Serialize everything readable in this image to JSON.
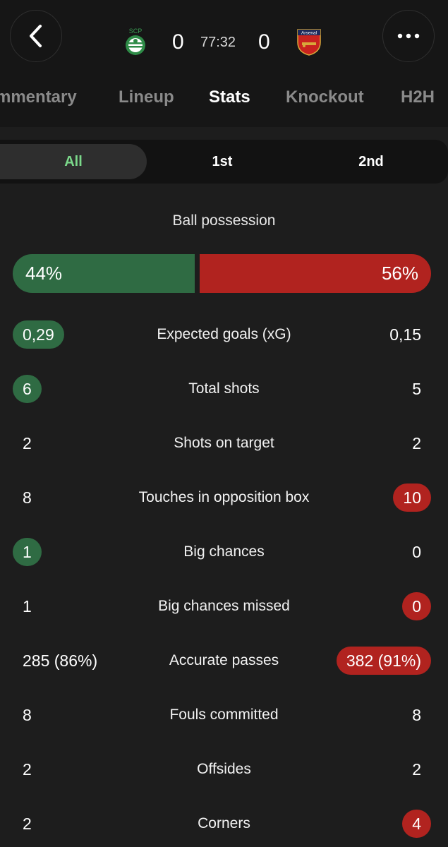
{
  "header": {
    "back_icon": "chevron-left-icon",
    "more_icon": "ellipsis-icon",
    "home_crest": "sporting-cp-crest",
    "away_crest": "arsenal-crest",
    "away_crest_text": "Arsenal",
    "home_crest_text": "SCP",
    "home_score": "0",
    "away_score": "0",
    "clock": "77:32"
  },
  "tabs": [
    {
      "label": "mmentary",
      "active": false
    },
    {
      "label": "Lineup",
      "active": false
    },
    {
      "label": "Stats",
      "active": true
    },
    {
      "label": "Knockout",
      "active": false
    },
    {
      "label": "H2H",
      "active": false
    }
  ],
  "periods": [
    {
      "label": "All",
      "selected": true
    },
    {
      "label": "1st",
      "selected": false
    },
    {
      "label": "2nd",
      "selected": false
    }
  ],
  "possession": {
    "title": "Ball possession",
    "home": "44%",
    "away": "56%",
    "home_fraction": 0.44
  },
  "stats": [
    {
      "label": "Expected goals (xG)",
      "home": "0,29",
      "away": "0,15",
      "winner": "home"
    },
    {
      "label": "Total shots",
      "home": "6",
      "away": "5",
      "winner": "home"
    },
    {
      "label": "Shots on target",
      "home": "2",
      "away": "2",
      "winner": "none"
    },
    {
      "label": "Touches in opposition box",
      "home": "8",
      "away": "10",
      "winner": "away"
    },
    {
      "label": "Big chances",
      "home": "1",
      "away": "0",
      "winner": "home"
    },
    {
      "label": "Big chances missed",
      "home": "1",
      "away": "0",
      "winner": "away"
    },
    {
      "label": "Accurate passes",
      "home": "285 (86%)",
      "away": "382 (91%)",
      "winner": "away"
    },
    {
      "label": "Fouls committed",
      "home": "8",
      "away": "8",
      "winner": "none"
    },
    {
      "label": "Offsides",
      "home": "2",
      "away": "2",
      "winner": "none"
    },
    {
      "label": "Corners",
      "home": "2",
      "away": "4",
      "winner": "away"
    }
  ],
  "colors": {
    "home_accent": "#2f6b43",
    "away_accent": "#b1231f",
    "selected_period": "#7bd88a"
  }
}
